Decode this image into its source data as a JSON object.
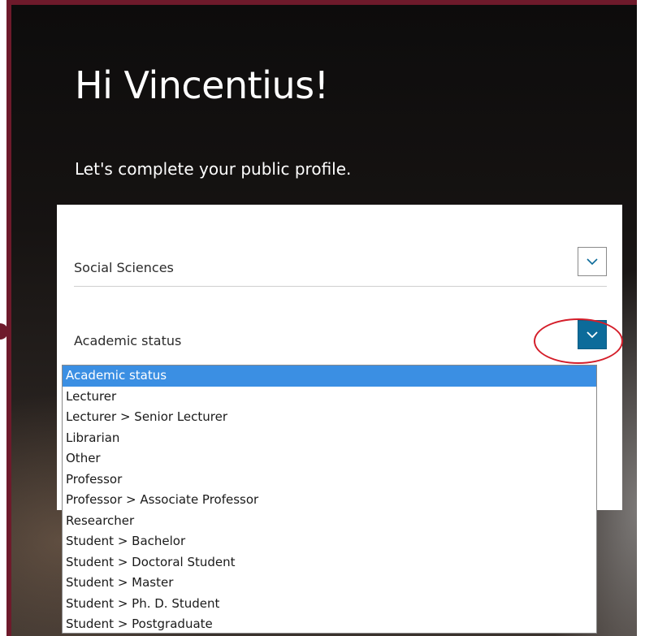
{
  "page": {
    "greeting": "Hi Vincentius!",
    "subtitle": "Let's complete your public profile."
  },
  "form": {
    "subject_field": {
      "value": "Social Sciences",
      "toggle_icon": "chevron-down-icon"
    },
    "status_field": {
      "value": "Academic status",
      "toggle_icon": "chevron-down-icon",
      "open": true
    }
  },
  "dropdown": {
    "selected_index": 0,
    "options": [
      "Academic status",
      "Lecturer",
      "Lecturer > Senior Lecturer",
      "Librarian",
      "Other",
      "Professor",
      "Professor > Associate Professor",
      "Researcher",
      "Student > Bachelor",
      "Student > Doctoral Student",
      "Student > Master",
      "Student > Ph. D. Student",
      "Student > Postgraduate"
    ]
  },
  "colors": {
    "accent_blue": "#0c6b9a",
    "selection_blue": "#3b8fe3",
    "annotation_red": "#d41e2a",
    "frame_maroon": "#6e1a2b"
  }
}
